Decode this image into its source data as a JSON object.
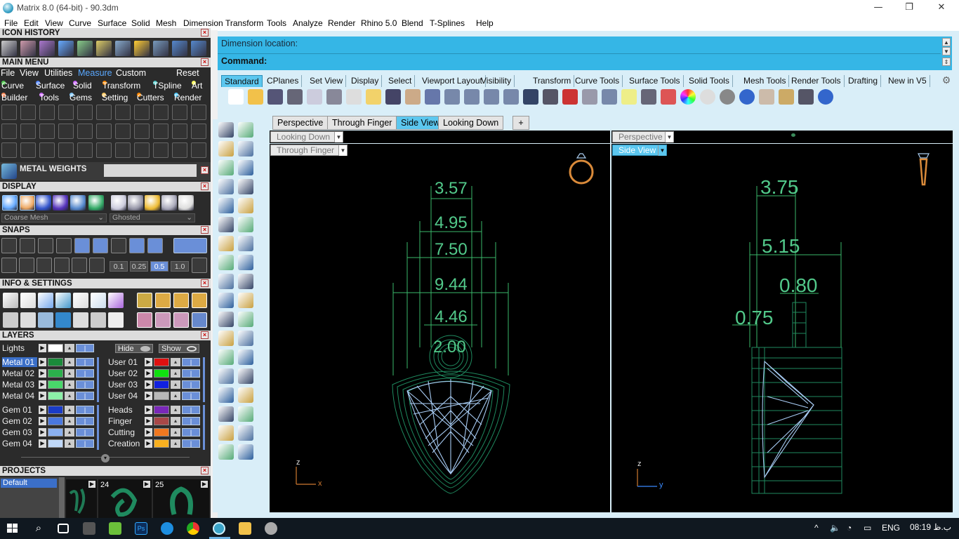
{
  "window": {
    "title": "Matrix 8.0 (64-bit) - 90.3dm",
    "minimize": "—",
    "restore": "❐",
    "close": "✕"
  },
  "menubar": [
    "File",
    "Edit",
    "View",
    "Curve",
    "Surface",
    "Solid",
    "Mesh",
    "Dimension",
    "Transform",
    "Tools",
    "Analyze",
    "Render",
    "Rhino 5.0",
    "Blend",
    "T-Splines",
    "Help"
  ],
  "left": {
    "icon_history": "ICON HISTORY",
    "main_menu": {
      "title": "MAIN MENU",
      "row1": [
        "File",
        "View",
        "Utilities",
        "Measure",
        "Custom",
        "Reset"
      ],
      "row2": [
        "Curve",
        "Surface",
        "Solid",
        "Transform",
        "TSpline",
        "Art"
      ],
      "row3": [
        "Builder",
        "Tools",
        "Gems",
        "Setting",
        "Cutters",
        "Render"
      ],
      "accent": "#5aa8ff"
    },
    "metal_weights": "METAL WEIGHTS",
    "display": {
      "title": "DISPLAY",
      "mesh_select": "Coarse Mesh",
      "mode_select": "Ghosted"
    },
    "snaps": {
      "title": "SNAPS",
      "values": [
        "0.1",
        "0.25",
        "0.5",
        "1.0"
      ]
    },
    "info": "INFO & SETTINGS",
    "layers": {
      "title": "LAYERS",
      "lights": "Lights",
      "hide": "Hide",
      "show": "Show",
      "left_col": [
        {
          "name": "Metal 01",
          "color": "#1a8a3a",
          "selected": true
        },
        {
          "name": "Metal 02",
          "color": "#2bb04c"
        },
        {
          "name": "Metal 03",
          "color": "#48d86a"
        },
        {
          "name": "Metal 04",
          "color": "#8cf0a8"
        },
        {
          "name": "Gem 01",
          "color": "#1a3cc8"
        },
        {
          "name": "Gem 02",
          "color": "#4a78e0"
        },
        {
          "name": "Gem 03",
          "color": "#8ab0f0"
        },
        {
          "name": "Gem 04",
          "color": "#c0d8f8"
        }
      ],
      "right_col": [
        {
          "name": "User 01",
          "color": "#e01010"
        },
        {
          "name": "User 02",
          "color": "#10e010"
        },
        {
          "name": "User 03",
          "color": "#1020e0"
        },
        {
          "name": "User 04",
          "color": "#b8b8b8"
        },
        {
          "name": "Heads",
          "color": "#7a28b8"
        },
        {
          "name": "Finger",
          "color": "#a84848"
        },
        {
          "name": "Cutting",
          "color": "#f07820"
        },
        {
          "name": "Creation",
          "color": "#f8b020"
        }
      ]
    },
    "projects": {
      "title": "PROJECTS",
      "default": "Default",
      "thumbs": [
        "24",
        "25"
      ]
    }
  },
  "command": {
    "line1": "Dimension location:",
    "line2": "Command:"
  },
  "toolbar_tabs": [
    "Standard",
    "CPlanes",
    "Set View",
    "Display",
    "Select",
    "Viewport Layout",
    "Visibility",
    "Transform",
    "Curve Tools",
    "Surface Tools",
    "Solid Tools",
    "Mesh Tools",
    "Render Tools",
    "Drafting",
    "New in V5"
  ],
  "viewport_tabs": [
    "Perspective",
    "Through Finger",
    "Side View",
    "Looking Down"
  ],
  "viewport_tab_add": "+",
  "viewports": {
    "top_left_title": "Looking Down",
    "top_right_title": "Perspective",
    "left_title": "Through Finger",
    "right_title": "Side View",
    "left_dims": [
      "3.57",
      "4.95",
      "7.50",
      "9.44",
      "4.46",
      "2.00"
    ],
    "right_dims": [
      "3.75",
      "5.15",
      "0.80",
      "0.75"
    ],
    "left_axes": [
      "z",
      "x"
    ],
    "right_axes": [
      "z",
      "y"
    ]
  },
  "taskbar": {
    "lang": "ENG",
    "time": "08:19 ب.ظ"
  }
}
